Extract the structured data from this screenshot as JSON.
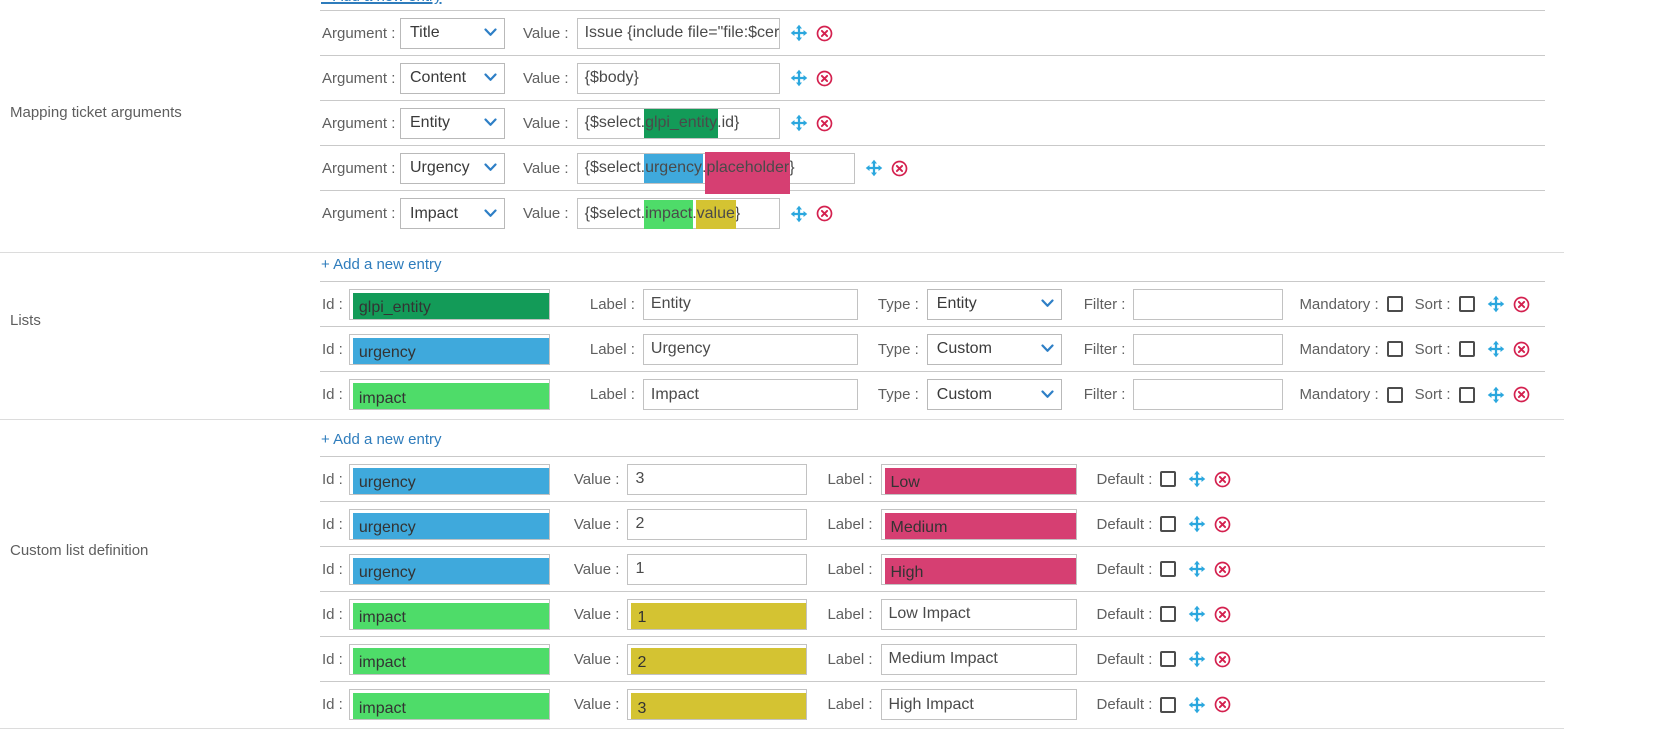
{
  "colors": {
    "link": "#2e7cbc",
    "highlight_dark_green": "#139b58",
    "highlight_blue": "#3fa9dc",
    "highlight_light_green": "#4edc69",
    "highlight_pink": "#d63f72",
    "highlight_yellow": "#d4c332",
    "move_icon": "#2ba7de",
    "delete_icon": "#d4214f"
  },
  "labels": {
    "argument": "Argument :",
    "value": "Value :",
    "id": "Id :",
    "label": "Label :",
    "type": "Type :",
    "filter": "Filter :",
    "mandatory": "Mandatory :",
    "sort": "Sort :",
    "default": "Default :"
  },
  "add_entry": "+ Add a new entry",
  "sections": {
    "mapping": {
      "title": "Mapping ticket arguments",
      "rows": [
        {
          "argument": "Title",
          "parts": [
            "Issue {include file=\"file:$cer"
          ]
        },
        {
          "argument": "Content",
          "parts": [
            "{$body}"
          ]
        },
        {
          "argument": "Entity",
          "parts": [
            "{$select.",
            "glpi_entity",
            ".id}"
          ]
        },
        {
          "argument": "Urgency",
          "parts": [
            "{$select.",
            "urgency",
            ".",
            "placeholder",
            "}"
          ]
        },
        {
          "argument": "Impact",
          "parts": [
            "{$select.",
            "impact",
            ".",
            "value",
            "}"
          ]
        }
      ]
    },
    "lists": {
      "title": "Lists",
      "rows": [
        {
          "id": "glpi_entity",
          "label": "Entity",
          "type": "Entity",
          "filter": "",
          "mandatory": false,
          "sort": false
        },
        {
          "id": "urgency",
          "label": "Urgency",
          "type": "Custom",
          "filter": "",
          "mandatory": false,
          "sort": false
        },
        {
          "id": "impact",
          "label": "Impact",
          "type": "Custom",
          "filter": "",
          "mandatory": false,
          "sort": false
        }
      ]
    },
    "custom": {
      "title": "Custom list definition",
      "rows": [
        {
          "id": "urgency",
          "value": "3",
          "label": "Low",
          "default": false
        },
        {
          "id": "urgency",
          "value": "2",
          "label": "Medium",
          "default": false
        },
        {
          "id": "urgency",
          "value": "1",
          "label": "High",
          "default": false
        },
        {
          "id": "impact",
          "value": "1",
          "label": "Low Impact",
          "default": false
        },
        {
          "id": "impact",
          "value": "2",
          "label": "Medium Impact",
          "default": false
        },
        {
          "id": "impact",
          "value": "3",
          "label": "High Impact",
          "default": false
        }
      ]
    }
  }
}
